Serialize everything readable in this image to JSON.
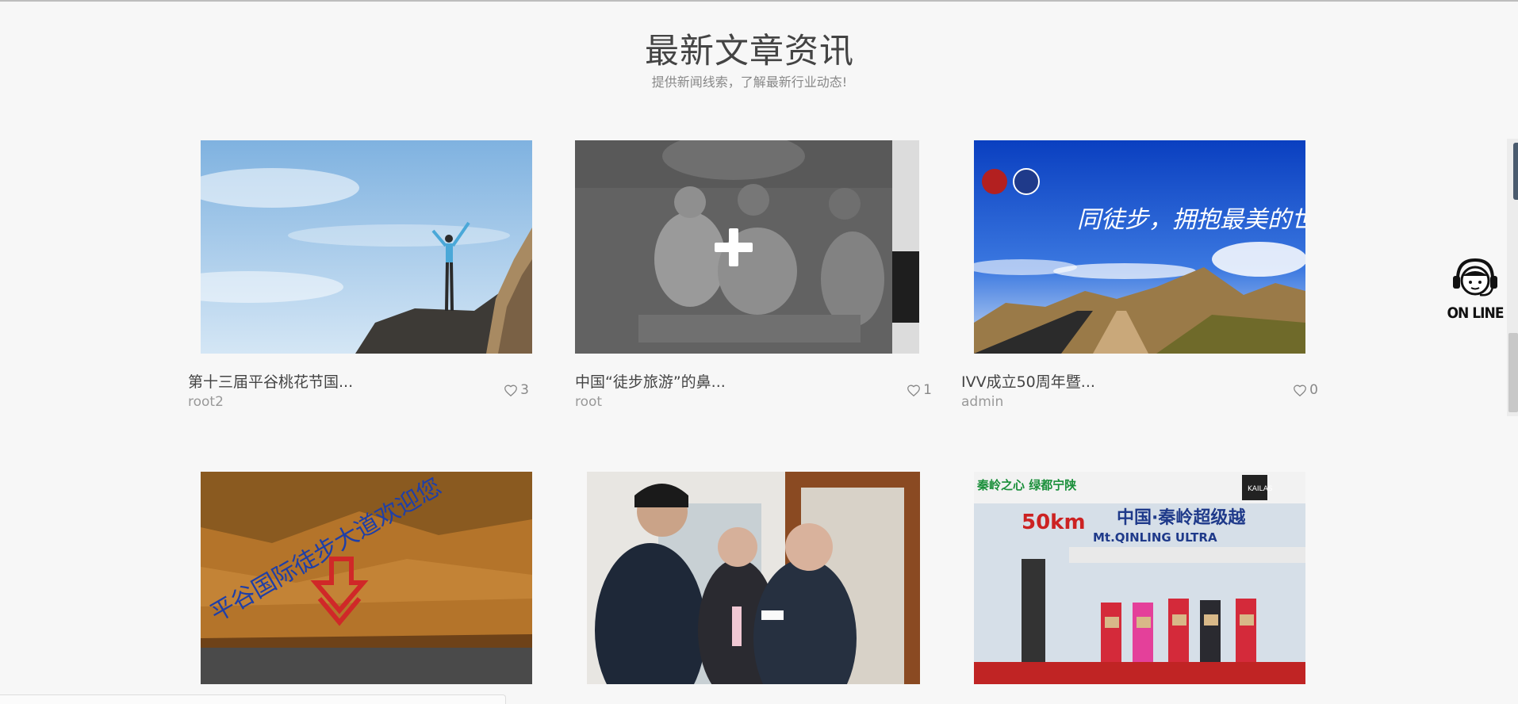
{
  "section": {
    "title": "最新文章资讯",
    "subtitle": "提供新闻线索，了解最新行业动态!"
  },
  "online": {
    "label": "ON LINE",
    "icon": "headset-support-icon"
  },
  "articles": [
    {
      "title": "第十三届平谷桃花节国...",
      "author": "root2",
      "likes": "3",
      "image": "hiker-on-cliff-photo"
    },
    {
      "title": "中国“徒步旅游”的鼻...",
      "author": "root",
      "likes": "1",
      "image": "historic-bw-group-photo",
      "hover_icon": "plus-icon"
    },
    {
      "title": "IVV成立50周年暨...",
      "author": "admin",
      "likes": "0",
      "image": "mountain-road-banner",
      "banner_text": "同徒步，拥抱最美的世界"
    },
    {
      "image": "cliff-inscription-photo",
      "inscription": "平谷国际徒步大道欢迎您"
    },
    {
      "image": "handshake-meeting-photo"
    },
    {
      "image": "ultra-race-award-photo",
      "banner": {
        "tagline": "秦岭之心 绿都宁陕",
        "brand": "KAILAS",
        "distance": "50km",
        "event": "中国·秦岭超级越",
        "event_en": "Mt.QINLING ULTRA"
      }
    }
  ],
  "colors": {
    "accent": "#e53935",
    "heading": "#444444",
    "muted": "#999999"
  }
}
